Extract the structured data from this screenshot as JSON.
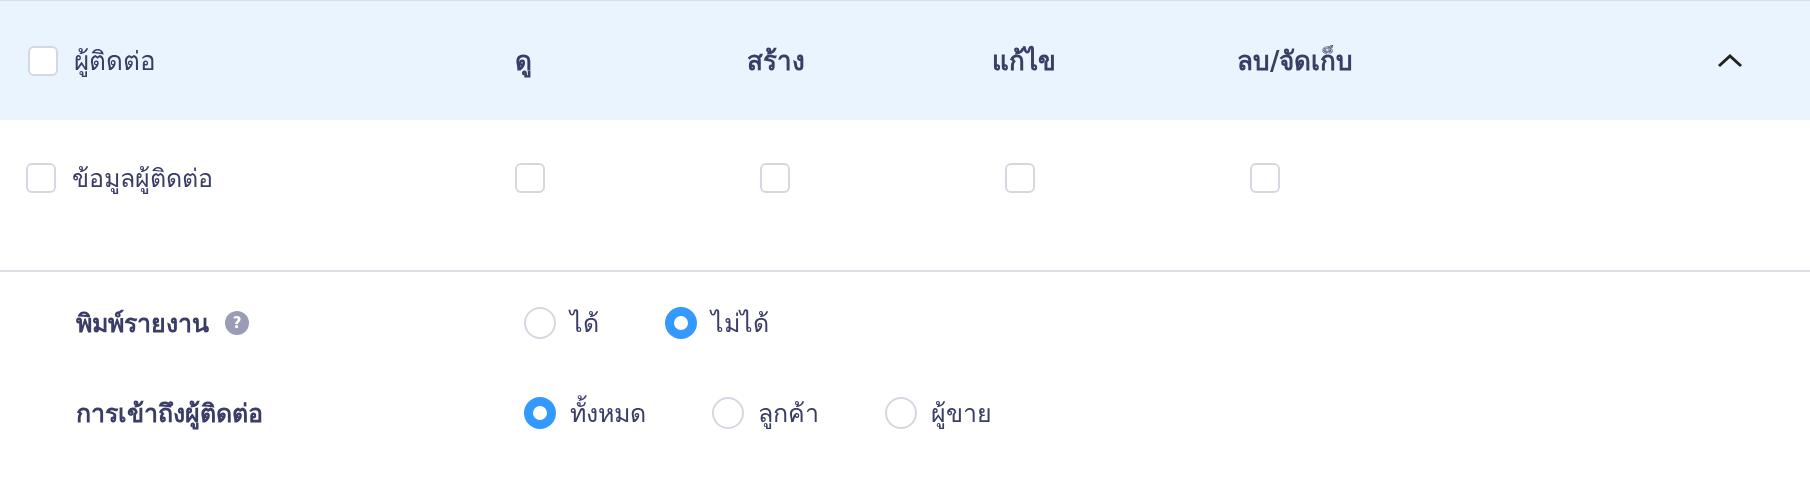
{
  "table": {
    "header": {
      "label": "ผู้ติดต่อ",
      "checked": false,
      "columns": [
        "ดู",
        "สร้าง",
        "แก้ไข",
        "ลบ/จัดเก็บ"
      ],
      "expanded": true
    },
    "rows": [
      {
        "label": "ข้อมูลผู้ติดต่อ",
        "checked": false,
        "permissions": [
          {
            "checked": false
          },
          {
            "checked": false
          },
          {
            "checked": false
          },
          {
            "checked": false
          }
        ]
      }
    ]
  },
  "settings": [
    {
      "label": "พิมพ์รายงาน",
      "help": "?",
      "options": [
        {
          "label": "ได้",
          "selected": false
        },
        {
          "label": "ไม่ได้",
          "selected": true
        }
      ]
    },
    {
      "label": "การเข้าถึงผู้ติดต่อ",
      "options": [
        {
          "label": "ทั้งหมด",
          "selected": true
        },
        {
          "label": "ลูกค้า",
          "selected": false
        },
        {
          "label": "ผู้ขาย",
          "selected": false
        }
      ]
    }
  ]
}
